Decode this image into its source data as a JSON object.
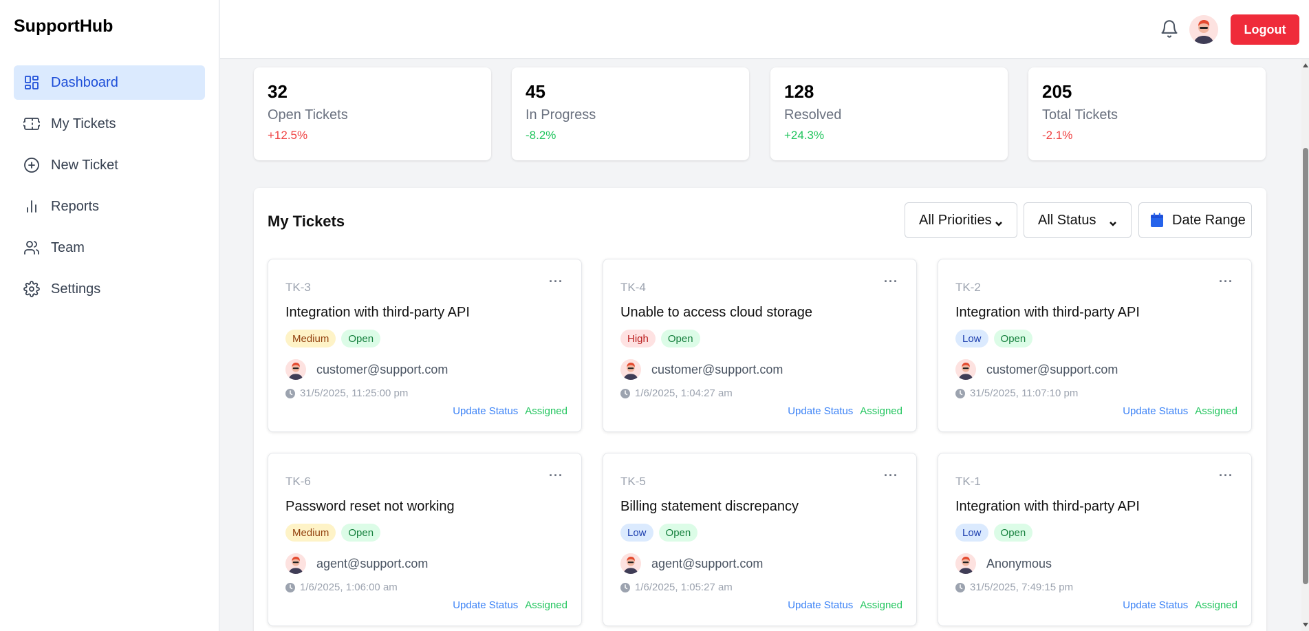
{
  "app": {
    "brand": "SupportHub"
  },
  "sidebar": {
    "items": [
      {
        "label": "Dashboard",
        "icon": "dashboard-icon",
        "active": true
      },
      {
        "label": "My Tickets",
        "icon": "ticket-icon",
        "active": false
      },
      {
        "label": "New Ticket",
        "icon": "plus-circle-icon",
        "active": false
      },
      {
        "label": "Reports",
        "icon": "bar-chart-icon",
        "active": false
      },
      {
        "label": "Team",
        "icon": "users-icon",
        "active": false
      },
      {
        "label": "Settings",
        "icon": "gear-icon",
        "active": false
      }
    ]
  },
  "header": {
    "logout_label": "Logout"
  },
  "stats": [
    {
      "value": "32",
      "label": "Open Tickets",
      "change": "+12.5%"
    },
    {
      "value": "45",
      "label": "In Progress",
      "change": "-8.2%"
    },
    {
      "value": "128",
      "label": "Resolved",
      "change": "+24.3%"
    },
    {
      "value": "205",
      "label": "Total Tickets",
      "change": "-2.1%"
    }
  ],
  "tickets_panel": {
    "title": "My Tickets",
    "priority_filter": "All Priorities",
    "status_filter": "All Status",
    "date_range_label": "Date Range",
    "tickets": [
      {
        "id": "TK-3",
        "title": "Integration with third-party API",
        "priority": "Medium",
        "status": "Open",
        "user": "customer@support.com",
        "time": "31/5/2025, 11:25:00 pm",
        "update_label": "Update Status",
        "assigned_label": "Assigned"
      },
      {
        "id": "TK-4",
        "title": "Unable to access cloud storage",
        "priority": "High",
        "status": "Open",
        "user": "customer@support.com",
        "time": "1/6/2025, 1:04:27 am",
        "update_label": "Update Status",
        "assigned_label": "Assigned"
      },
      {
        "id": "TK-2",
        "title": "Integration with third-party API",
        "priority": "Low",
        "status": "Open",
        "user": "customer@support.com",
        "time": "31/5/2025, 11:07:10 pm",
        "update_label": "Update Status",
        "assigned_label": "Assigned"
      },
      {
        "id": "TK-6",
        "title": "Password reset not working",
        "priority": "Medium",
        "status": "Open",
        "user": "agent@support.com",
        "time": "1/6/2025, 1:06:00 am",
        "update_label": "Update Status",
        "assigned_label": "Assigned"
      },
      {
        "id": "TK-5",
        "title": "Billing statement discrepancy",
        "priority": "Low",
        "status": "Open",
        "user": "agent@support.com",
        "time": "1/6/2025, 1:05:27 am",
        "update_label": "Update Status",
        "assigned_label": "Assigned"
      },
      {
        "id": "TK-1",
        "title": "Integration with third-party API",
        "priority": "Low",
        "status": "Open",
        "user": "Anonymous",
        "time": "31/5/2025, 7:49:15 pm",
        "update_label": "Update Status",
        "assigned_label": "Assigned"
      }
    ]
  },
  "colors": {
    "accent": "#1d4ed8",
    "logout": "#ef2b3a",
    "positive": "#22c55e",
    "negative": "#ef4444"
  }
}
